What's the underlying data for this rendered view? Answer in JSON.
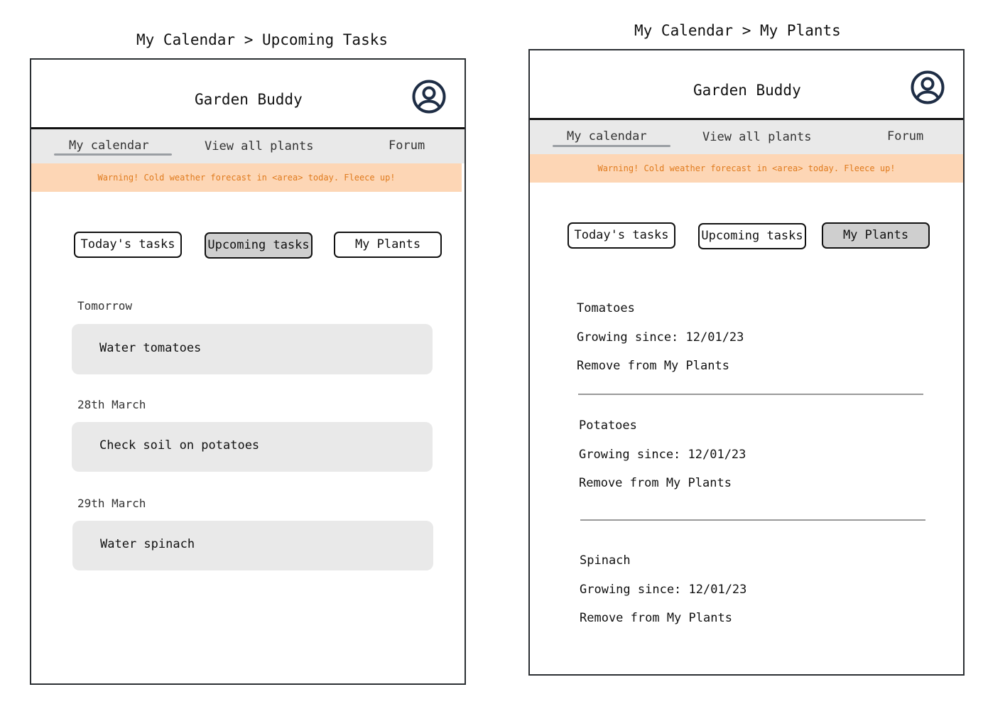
{
  "left_screen": {
    "caption": "My Calendar > Upcoming Tasks",
    "app_title": "Garden Buddy",
    "nav": {
      "my_calendar": "My calendar",
      "view_all_plants": "View all plants",
      "forum": "Forum"
    },
    "warning": "Warning! Cold weather forecast in <area> today. Fleece up!",
    "tabs": {
      "todays": "Today's tasks",
      "upcoming": "Upcoming tasks",
      "my_plants": "My Plants"
    },
    "groups": [
      {
        "date": "Tomorrow",
        "task": "Water tomatoes"
      },
      {
        "date": "28th March",
        "task": "Check soil on potatoes"
      },
      {
        "date": "29th March",
        "task": "Water spinach"
      }
    ]
  },
  "right_screen": {
    "caption": "My Calendar > My Plants",
    "app_title": "Garden Buddy",
    "nav": {
      "my_calendar": "My calendar",
      "view_all_plants": "View all plants",
      "forum": "Forum"
    },
    "warning": "Warning! Cold weather forecast in <area> today. Fleece up!",
    "tabs": {
      "todays": "Today's tasks",
      "upcoming": "Upcoming tasks",
      "my_plants": "My Plants"
    },
    "plants": [
      {
        "name": "Tomatoes",
        "growing": "Growing since: 12/01/23",
        "remove": "Remove from My Plants"
      },
      {
        "name": "Potatoes",
        "growing": "Growing since: 12/01/23",
        "remove": "Remove from My Plants"
      },
      {
        "name": "Spinach",
        "growing": "Growing since: 12/01/23",
        "remove": "Remove from My Plants"
      }
    ]
  },
  "colors": {
    "warning_bg": "#fdd6b5",
    "warning_text": "#e07b1e",
    "nav_bg": "#e9e9e9",
    "card_bg": "#e9e9e9",
    "active_tab": "#cfcfcf",
    "avatar": "#1e2d45"
  },
  "icons": {
    "profile": "user-circle-icon"
  }
}
